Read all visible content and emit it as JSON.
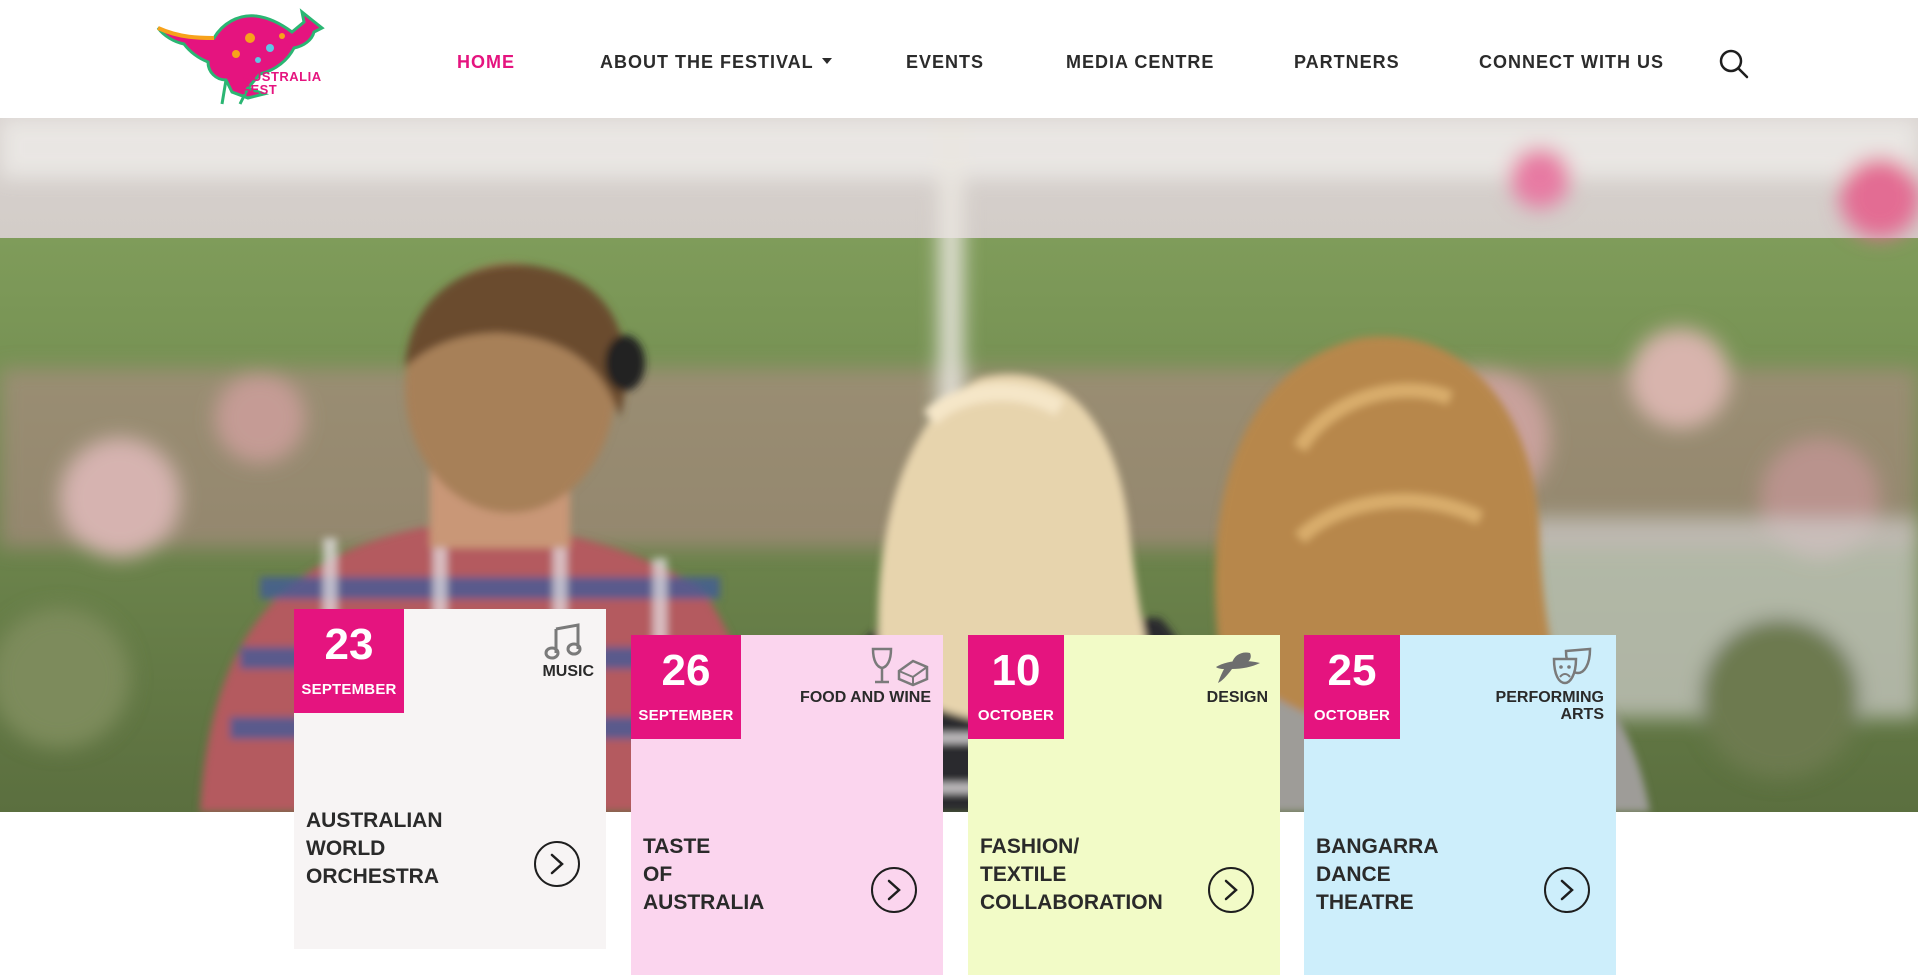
{
  "brand": {
    "logo_text_line1": "AUSTRALIA",
    "logo_text_line2": "FEST",
    "logo_icon": "kangaroo-logo",
    "accent_color": "#e5147f"
  },
  "nav": {
    "items": [
      {
        "label": "HOME",
        "active": true
      },
      {
        "label": "ABOUT THE FESTIVAL",
        "has_dropdown": true
      },
      {
        "label": "EVENTS"
      },
      {
        "label": "MEDIA CENTRE"
      },
      {
        "label": "PARTNERS"
      },
      {
        "label": "CONNECT WITH US"
      }
    ],
    "search_icon": "search-icon"
  },
  "hero": {
    "image_icon": "festival-crowd-photo"
  },
  "events": [
    {
      "day": "23",
      "month": "SEPTEMBER",
      "category": "MUSIC",
      "category_icon": "music-note-icon",
      "title_lines": [
        "AUSTRALIAN",
        "WORLD",
        "ORCHESTRA"
      ],
      "bg_color": "#f7f4f4"
    },
    {
      "day": "26",
      "month": "SEPTEMBER",
      "category": "FOOD AND WINE",
      "category_icon": "wine-glass-icon",
      "title_lines": [
        "TASTE",
        "OF",
        "AUSTRALIA"
      ],
      "bg_color": "#fbd5ee"
    },
    {
      "day": "10",
      "month": "OCTOBER",
      "category": "DESIGN",
      "category_icon": "fashion-hat-icon",
      "title_lines": [
        "FASHION/",
        "TEXTILE",
        "COLLABORATION"
      ],
      "bg_color": "#f2fbc7"
    },
    {
      "day": "25",
      "month": "OCTOBER",
      "category_line1": "PERFORMING",
      "category_line2": "ARTS",
      "category_icon": "theatre-masks-icon",
      "title_lines": [
        "BANGARRA",
        "DANCE",
        "THEATRE"
      ],
      "bg_color": "#cdeefb"
    }
  ]
}
